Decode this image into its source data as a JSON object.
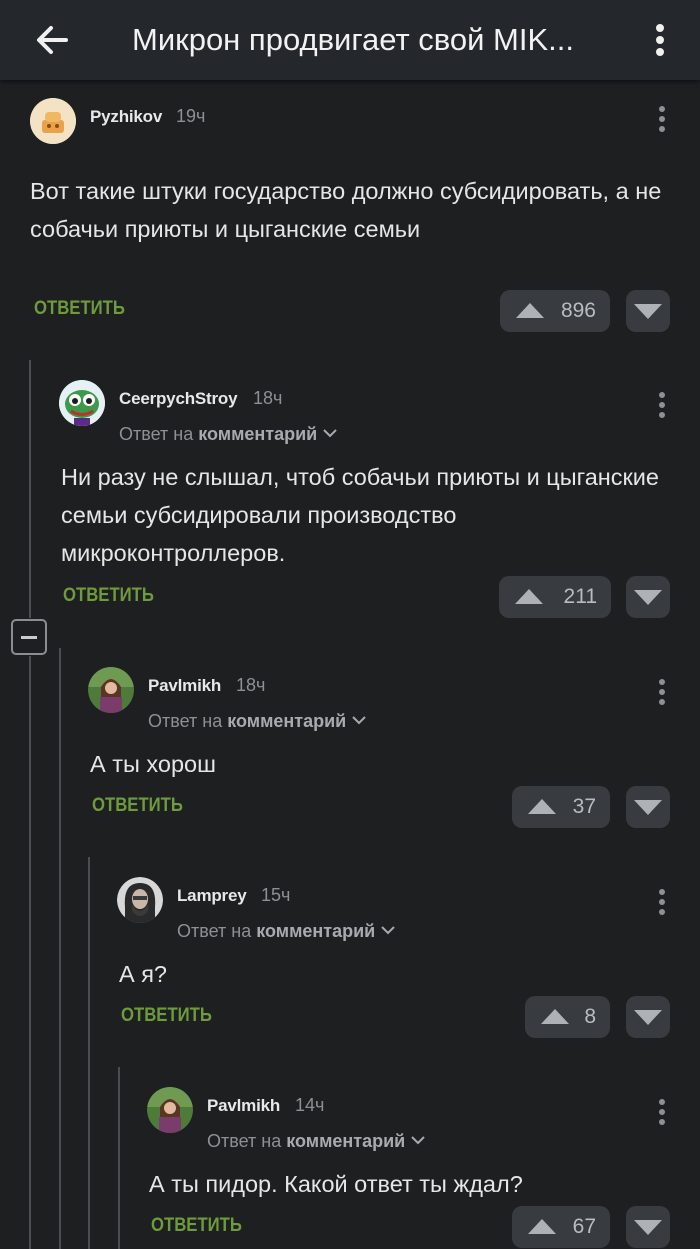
{
  "header": {
    "title": "Микрон продвигает свой MIK..."
  },
  "reply_label": "ОТВЕТИТЬ",
  "reply_to": {
    "prefix": "Ответ на",
    "target": "комментарий"
  },
  "comments": [
    {
      "author": "Pyzhikov",
      "time": "19ч",
      "text": "Вот такие штуки государство должно субсидировать, а не собачьи приюты и цыганские семьи",
      "votes": "896"
    },
    {
      "author": "CeerpychStroy",
      "time": "18ч",
      "text": "Ни разу не слышал, чтоб собачьи приюты и цыганские семьи субсидировали производство микроконтроллеров.",
      "votes": "211"
    },
    {
      "author": "Pavlmikh",
      "time": "18ч",
      "text": "А ты хорош",
      "votes": "37"
    },
    {
      "author": "Lamprey",
      "time": "15ч",
      "text": "А я?",
      "votes": "8"
    },
    {
      "author": "Pavlmikh",
      "time": "14ч",
      "text": "А ты пидор. Какой ответ ты ждал?",
      "votes": "67"
    }
  ],
  "colors": {
    "background": "#1d1f21",
    "appbar": "#24272b",
    "accent_reply": "#6e9b3c",
    "vote_bg": "#383b40"
  },
  "icons": [
    "back-arrow-icon",
    "more-vertical-icon",
    "chevron-down-icon",
    "upvote-icon",
    "downvote-icon",
    "collapse-minus-icon"
  ]
}
